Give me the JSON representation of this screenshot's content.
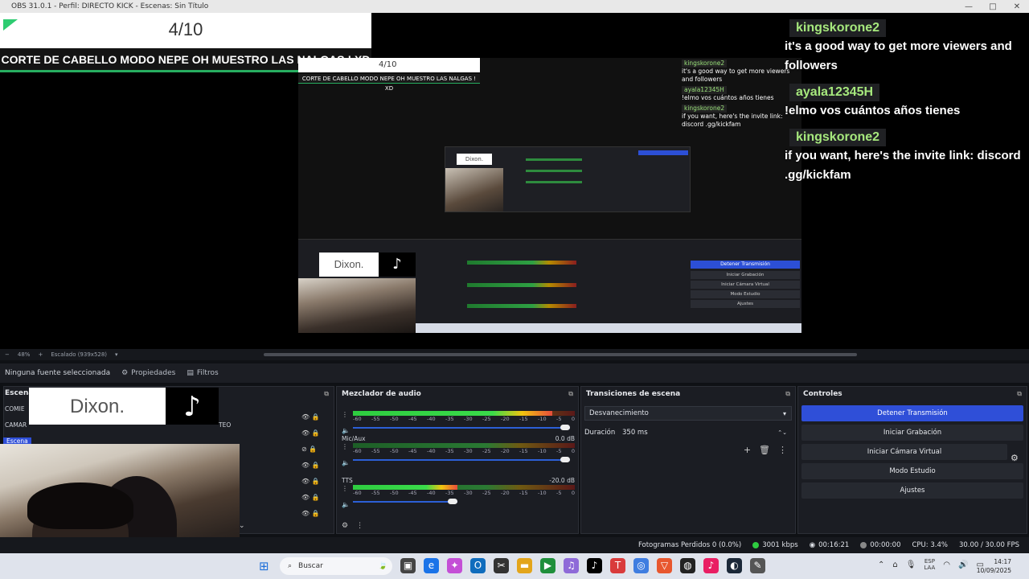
{
  "window": {
    "title": "OBS 31.0.1 - Perfil: DIRECTO KICK - Escenas: Sin Título",
    "controls": [
      "—",
      "□",
      "✕"
    ]
  },
  "preview": {
    "counter": "4/10",
    "stream_title": "CORTE DE CABELLO MODO NEPE OH MUESTRO LAS NALGAS ! XD",
    "nested_brand": "Dixon.",
    "chat": [
      {
        "user": "kingskorone2",
        "text": "it's a good way to get more viewers and followers"
      },
      {
        "user": "ayala12345H",
        "text": "!elmo vos cuántos años tienes"
      },
      {
        "user": "kingskorone2",
        "text": "if you want, here's the invite link: discord .gg/kickfam"
      }
    ]
  },
  "zoom": {
    "percent": "48%",
    "mode": "Escalado (939x528)"
  },
  "source_toolbar": {
    "no_source": "Ninguna fuente seleccionada",
    "properties": "Propiedades",
    "filters": "Filtros"
  },
  "scenes": {
    "header": "Escena",
    "items": [
      "COMIE",
      "CAMAR",
      "Escena"
    ],
    "side_text": "TEO",
    "brand": "Dixon."
  },
  "mixer": {
    "header": "Mezclador de audio",
    "scale": [
      "-60",
      "-55",
      "-50",
      "-45",
      "-40",
      "-35",
      "-30",
      "-25",
      "-20",
      "-15",
      "-10",
      "-5",
      "0"
    ],
    "tracks": [
      {
        "name": "",
        "db": "",
        "level": 0.9,
        "fader": 0.98
      },
      {
        "name": "Mic/Aux",
        "db": "0.0 dB",
        "level": 0.0,
        "fader": 0.98
      },
      {
        "name": "TTS",
        "db": "-20.0 dB",
        "level": 0.47,
        "fader": 0.47
      }
    ]
  },
  "transitions": {
    "header": "Transiciones de escena",
    "selected": "Desvanecimiento",
    "duration_label": "Duración",
    "duration_value": "350 ms"
  },
  "controls": {
    "header": "Controles",
    "buttons": [
      "Detener Transmisión",
      "Iniciar Grabación",
      "Iniciar Cámara Virtual",
      "Modo Estudio",
      "Ajustes"
    ]
  },
  "status": {
    "dropped": "Fotogramas Perdidos 0 (0.0%)",
    "bitrate": "3001 kbps",
    "stream_time": "00:16:21",
    "rec_time": "00:00:00",
    "cpu": "CPU: 3.4%",
    "fps": "30.00 / 30.00 FPS",
    "colors": {
      "live": "#2ecc40",
      "rec": "#888888",
      "accent": "#2f4fd8"
    }
  },
  "taskbar": {
    "search_placeholder": "Buscar",
    "lang_top": "ESP",
    "lang_bottom": "LAA",
    "time": "14:17",
    "date": "10/09/2025"
  }
}
